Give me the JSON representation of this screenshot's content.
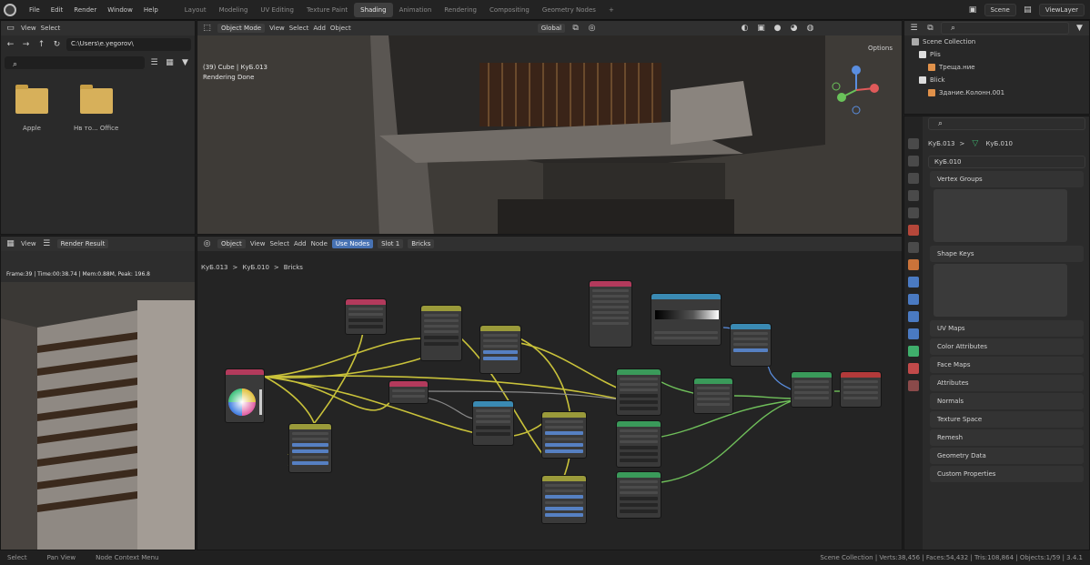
{
  "topbar": {
    "menu": [
      "File",
      "Edit",
      "Render",
      "Window",
      "Help"
    ],
    "workspaces": [
      "Layout",
      "Modeling",
      "UV Editing",
      "Texture Paint",
      "Shading",
      "Animation",
      "Rendering",
      "Compositing",
      "Geometry Nodes"
    ],
    "active_workspace": "Shading",
    "scene": "Scene",
    "view_layer": "ViewLayer"
  },
  "filebrowser": {
    "menu": [
      "View",
      "Select"
    ],
    "path": "C:\\Users\\e.yegorov\\",
    "folders": [
      "Apple",
      "Hв то... Office"
    ]
  },
  "viewport": {
    "mode": "Object Mode",
    "menu": [
      "View",
      "Select",
      "Add",
      "Object"
    ],
    "transform": "Global",
    "info_line1": "(39) Cube | КуБ.013",
    "info_line2": "Rendering Done",
    "options_label": "Options"
  },
  "outliner": {
    "title": "Scene Collection",
    "rows": [
      "Plis",
      "Треща.ние",
      "Blick",
      "Здание.Колонн.001"
    ]
  },
  "properties": {
    "breadcrumb_object": "КуБ.013",
    "breadcrumb_mesh": "КуБ.010",
    "mesh_name": "КуБ.010",
    "sections": [
      "UV Maps",
      "Color Attributes",
      "Face Maps",
      "Attributes",
      "Normals",
      "Texture Space",
      "Remesh",
      "Geometry Data",
      "Custom Properties"
    ],
    "list_sections": [
      "Vertex Groups",
      "Shape Keys"
    ]
  },
  "imgeditor": {
    "menu": [
      "View",
      "Render Result"
    ],
    "info": "Frame:39 | Time:00:38.74 | Mem:0.88M, Peak: 196.8"
  },
  "nodeeditor": {
    "menu": [
      "Object",
      "View",
      "Select",
      "Add",
      "Node",
      "Use Nodes"
    ],
    "slot": "Slot 1",
    "material": "Bricks",
    "breadcrumb_object": "КуБ.013",
    "breadcrumb_mesh": "КуБ.010",
    "breadcrumb_material": "Bricks"
  },
  "statusbar": {
    "left1": "Select",
    "left2": "Pan View",
    "left3": "Node Context Menu",
    "right": "Scene Collection | Verts:38,456 | Faces:54,432 | Tris:108,864 | Objects:1/59 | 3.4.1"
  }
}
